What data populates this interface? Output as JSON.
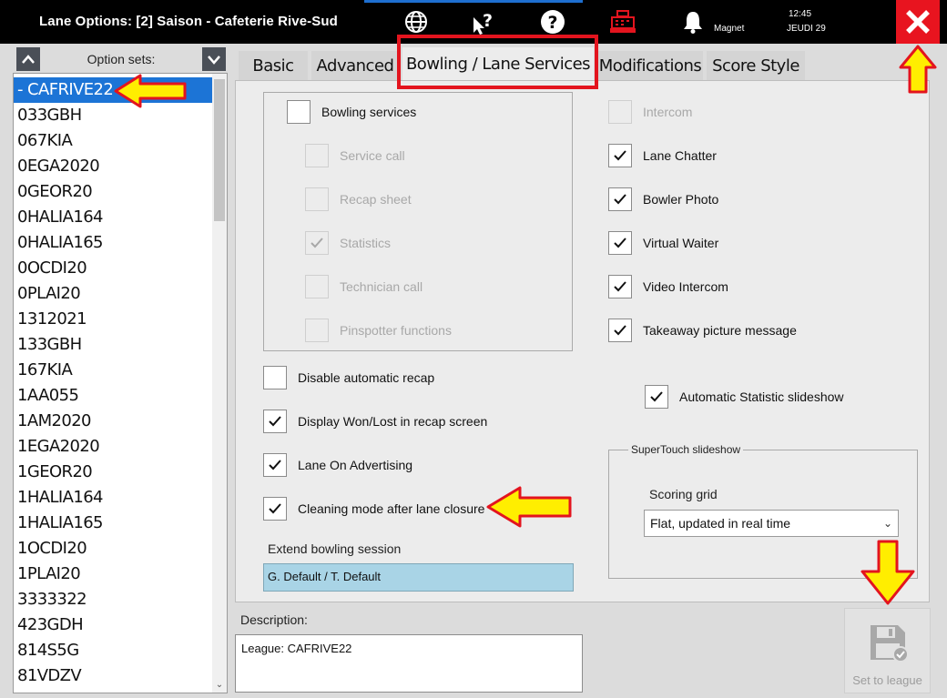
{
  "window": {
    "title": "Lane Options: [2] Saison - Cafeterie Rive-Sud",
    "magnet_label": "Magnet",
    "time": "12:45",
    "date": "JEUDI 29"
  },
  "option_sets": {
    "label": "Option sets:",
    "items": [
      "- CAFRIVE22",
      "033GBH",
      "067KIA",
      "0EGA2020",
      "0GEOR20",
      "0HALIA164",
      "0HALIA165",
      "0OCDI20",
      "0PLAI20",
      "1312021",
      "133GBH",
      "167KIA",
      "1AA055",
      "1AM2020",
      "1EGA2020",
      "1GEOR20",
      "1HALIA164",
      "1HALIA165",
      "1OCDI20",
      "1PLAI20",
      "3333322",
      "423GDH",
      "814S5G",
      "81VDZV"
    ],
    "selected_index": 0
  },
  "tabs": [
    "Basic",
    "Advanced",
    "Bowling / Lane Services",
    "Modifications",
    "Score Style"
  ],
  "active_tab": "Bowling / Lane Services",
  "bowling": {
    "bowling_services": "Bowling services",
    "service_call": "Service call",
    "recap_sheet": "Recap sheet",
    "statistics": "Statistics",
    "technician_call": "Technician call",
    "pinspotter_functions": "Pinspotter functions",
    "disable_auto_recap": "Disable automatic recap",
    "display_won_lost": "Display Won/Lost in recap screen",
    "lane_on_advertising": "Lane On Advertising",
    "cleaning_mode": "Cleaning mode after lane closure",
    "extend_session_label": "Extend bowling session",
    "extend_session_value": "G. Default / T. Default"
  },
  "lane": {
    "intercom": "Intercom",
    "lane_chatter": "Lane Chatter",
    "bowler_photo": "Bowler Photo",
    "virtual_waiter": "Virtual Waiter",
    "video_intercom": "Video Intercom",
    "takeaway_picture": "Takeaway picture message",
    "auto_stat_slideshow": "Automatic Statistic slideshow",
    "supertouch_legend": "SuperTouch slideshow",
    "scoring_grid_label": "Scoring grid",
    "scoring_grid_value": "Flat, updated in real time"
  },
  "description": {
    "label": "Description:",
    "value": "League: CAFRIVE22"
  },
  "set_to_league": "Set to league",
  "colors": {
    "titlebar": "#000000",
    "close_button": "#e8141f",
    "selection": "#1c74d6",
    "highlight": "#e3141e",
    "arrow_fill": "#ffee00",
    "arrow_stroke": "#e3141e"
  }
}
